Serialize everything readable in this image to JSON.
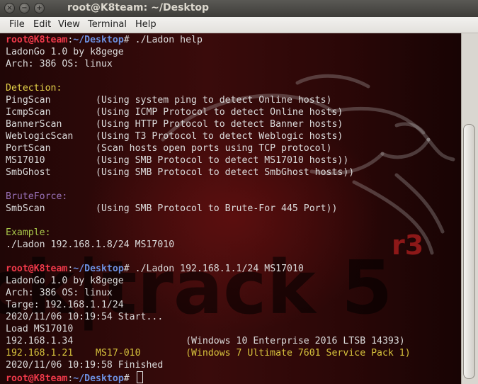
{
  "window": {
    "title": "root@K8team: ~/Desktop",
    "controls": {
      "close": "×",
      "minimize": "−",
      "maximize": "+"
    }
  },
  "menu": [
    "File",
    "Edit",
    "View",
    "Terminal",
    "Help"
  ],
  "terminal": {
    "lines": [
      [
        {
          "t": "root@K8team",
          "c": "u"
        },
        {
          "t": ":",
          "c": "p"
        },
        {
          "t": "~/Desktop",
          "c": "pth"
        },
        {
          "t": "# ./Ladon help",
          "c": "p"
        }
      ],
      [
        {
          "t": "LadonGo 1.0 by k8gege"
        }
      ],
      [
        {
          "t": "Arch: 386 OS: linux"
        }
      ],
      [
        {
          "t": ""
        }
      ],
      [
        {
          "t": "Detection:",
          "c": "yel"
        }
      ],
      [
        {
          "t": "PingScan        (Using system ping to detect Online hosts)"
        }
      ],
      [
        {
          "t": "IcmpScan        (Using ICMP Protocol to detect Online hosts)"
        }
      ],
      [
        {
          "t": "BannerScan      (Using HTTP Protocol to detect Banner hosts)"
        }
      ],
      [
        {
          "t": "WeblogicScan    (Using T3 Protocol to detect Weblogic hosts)"
        }
      ],
      [
        {
          "t": "PortScan        (Scan hosts open ports using TCP protocol)"
        }
      ],
      [
        {
          "t": "MS17010         (Using SMB Protocol to detect MS17010 hosts))"
        }
      ],
      [
        {
          "t": "SmbGhost        (Using SMB Protocol to detect SmbGhost hosts))"
        }
      ],
      [
        {
          "t": ""
        }
      ],
      [
        {
          "t": "BruteForce:",
          "c": "pur"
        }
      ],
      [
        {
          "t": "SmbScan         (Using SMB Protocol to Brute-For 445 Port))"
        }
      ],
      [
        {
          "t": ""
        }
      ],
      [
        {
          "t": "Example:",
          "c": "grn"
        }
      ],
      [
        {
          "t": "./Ladon 192.168.1.8/24 MS17010"
        }
      ],
      [
        {
          "t": ""
        }
      ],
      [
        {
          "t": "root@K8team",
          "c": "u"
        },
        {
          "t": ":",
          "c": "p"
        },
        {
          "t": "~/Desktop",
          "c": "pth"
        },
        {
          "t": "# ./Ladon 192.168.1.1/24 MS17010",
          "c": "p"
        }
      ],
      [
        {
          "t": "LadonGo 1.0 by k8gege"
        }
      ],
      [
        {
          "t": "Arch: 386 OS: linux"
        }
      ],
      [
        {
          "t": "Targe: 192.168.1.1/24"
        }
      ],
      [
        {
          "t": "2020/11/06 10:19:54 Start..."
        }
      ],
      [
        {
          "t": "Load MS17010"
        }
      ],
      [
        {
          "t": "192.168.1.34                    (Windows 10 Enterprise 2016 LTSB 14393)"
        }
      ],
      [
        {
          "t": "192.168.1.21    MS17-010        (Windows 7 Ultimate 7601 Service Pack 1)",
          "c": "hit"
        }
      ],
      [
        {
          "t": "2020/11/06 10:19:58 Finished"
        }
      ],
      [
        {
          "t": "root@K8team",
          "c": "u"
        },
        {
          "t": ":",
          "c": "p"
        },
        {
          "t": "~/Desktop",
          "c": "pth"
        },
        {
          "t": "# ",
          "c": "p"
        },
        {
          "cursor": true
        }
      ]
    ]
  },
  "background": {
    "logo_text": "ck|track 5",
    "logo_suffix": "r3",
    "dragon": "dragon-outline-icon"
  },
  "colors": {
    "user": "#f0394a",
    "path": "#6c8fdf",
    "detection_header": "#e6d34a",
    "bruteforce_header": "#9a72b9",
    "example_header": "#a8c64a",
    "vulnerable_host": "#d6c23c"
  }
}
